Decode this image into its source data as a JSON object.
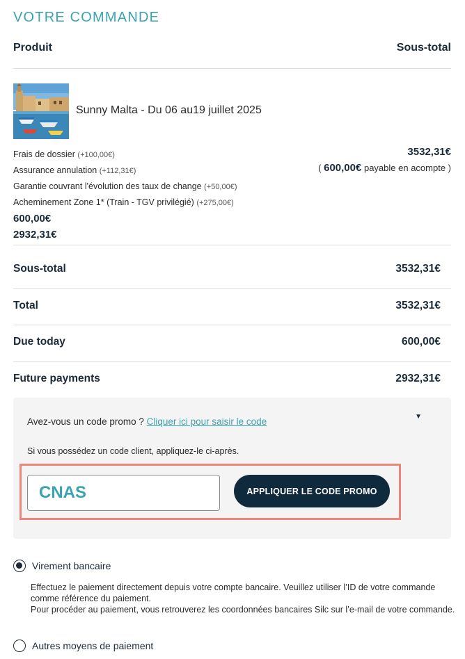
{
  "order": {
    "title": "VOTRE COMMANDE",
    "col_product": "Produit",
    "col_subtotal": "Sous-total"
  },
  "product": {
    "image_icon": "malta-harbour-photo",
    "name": "Sunny Malta - Du 06 au19 juillet 2025",
    "fees": [
      {
        "label": "Frais de dossier",
        "extra": "(+100,00€)"
      },
      {
        "label": "Assurance annulation",
        "extra": "(+112,31€)"
      },
      {
        "label": "Garantie couvrant l'évolution des taux de change",
        "extra": "(+50,00€)"
      },
      {
        "label": "Acheminement Zone 1* (Train - TGV privilégié)",
        "extra": "(+275,00€)"
      }
    ],
    "amount_due": "600,00€",
    "amount_future": "2932,31€",
    "line_total": "3532,31€",
    "deposit_open": "(",
    "deposit_amount": "600,00€",
    "deposit_text": "payable en acompte )"
  },
  "summary": [
    {
      "label": "Sous-total",
      "value": "3532,31€"
    },
    {
      "label": "Total",
      "value": "3532,31€"
    },
    {
      "label": "Due today",
      "value": "600,00€"
    },
    {
      "label": "Future payments",
      "value": "2932,31€"
    }
  ],
  "promo": {
    "question": "Avez-vous un code promo ?",
    "link": "Cliquer ici pour saisir le code",
    "hint": "Si vous possédez un code client, appliquez-le ci-après.",
    "code_value": "CNAS",
    "apply_label": "APPLIQUER LE CODE PROMO",
    "caret_icon": "caret-down-icon",
    "highlight_color": "#e9877c"
  },
  "payment": {
    "option1": "Virement bancaire",
    "option1_desc1": "Effectuez le paiement directement depuis votre compte bancaire. Veuillez utiliser l’ID de votre commande comme référence du paiement.",
    "option1_desc2": "Pour procéder au paiement, vous retrouverez les coordonnées bancaires Silc sur l’e-mail de votre commande.",
    "option2": "Autres moyens de paiement"
  },
  "colors": {
    "accent": "#3aa3b0",
    "dark": "#0f2a3d"
  }
}
